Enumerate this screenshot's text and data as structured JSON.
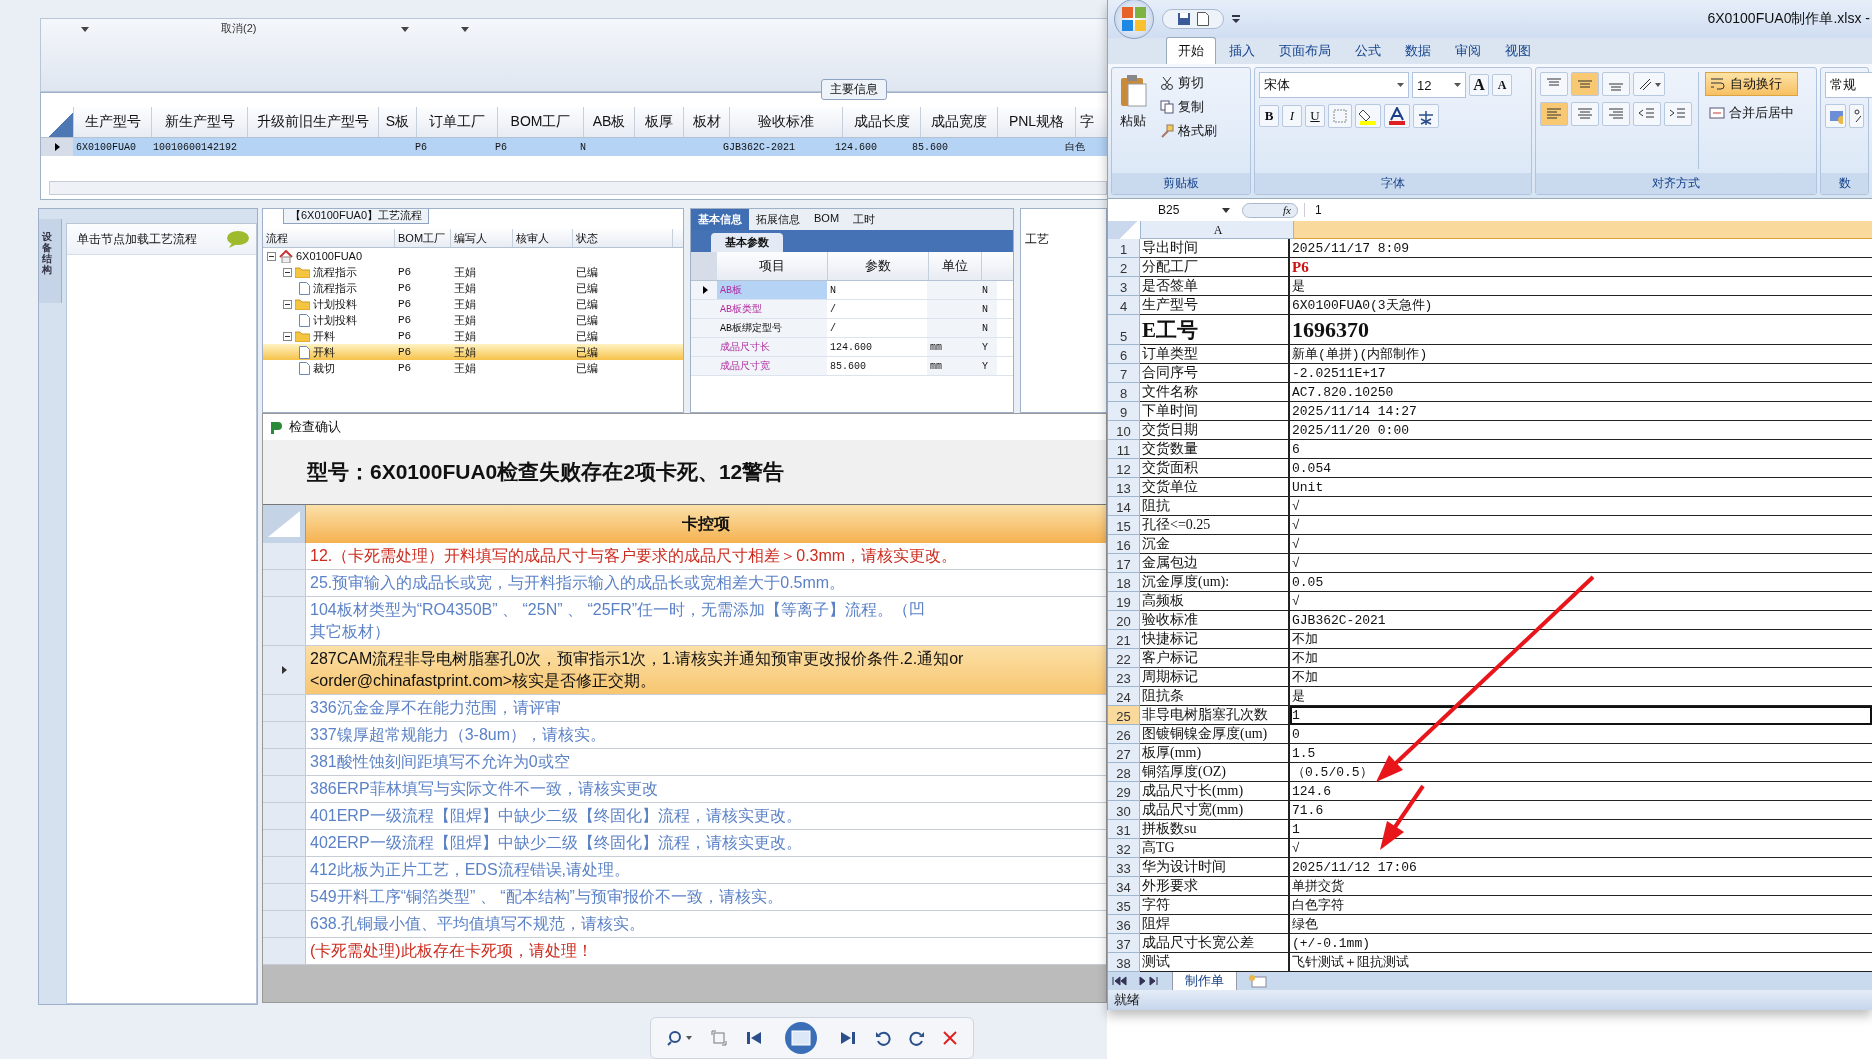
{
  "filter_bar": {
    "label": "取消(2)"
  },
  "main_info": {
    "title": "主要信息",
    "columns": [
      "生产型号",
      "新生产型号",
      "升级前旧生产型号",
      "S板",
      "订单工厂",
      "BOM工厂",
      "AB板",
      "板厚",
      "板材",
      "验收标准",
      "成品长度",
      "成品宽度",
      "PNL规格",
      "字"
    ],
    "rows": [
      {
        "selected": true,
        "cells": [
          "6X0100FUA0",
          "10010600142192",
          null,
          null,
          "P6",
          "P6",
          "N",
          null,
          null,
          "GJB362C-2021",
          "124.600",
          "85.600",
          null,
          "白色"
        ]
      }
    ]
  },
  "side_panel": {
    "tab": "设备结构",
    "hint": "单击节点加载工艺流程"
  },
  "process_panel": {
    "title": "【6X0100FUA0】工艺流程",
    "columns": [
      "流程",
      "BOM工厂",
      "编写人",
      "核审人",
      "状态"
    ],
    "tree": [
      {
        "label": "6X0100FUA0",
        "kind": "root",
        "expanded": true,
        "selected": false,
        "children": [
          {
            "label": "流程指示",
            "kind": "folder",
            "expanded": true,
            "selected": false,
            "factory": "P6",
            "author": "王娟",
            "status": "已编",
            "children": [
              {
                "label": "流程指示",
                "kind": "doc",
                "selected": false,
                "factory": "P6",
                "author": "王娟",
                "status": "已编"
              }
            ]
          },
          {
            "label": "计划投料",
            "kind": "folder",
            "expanded": true,
            "selected": false,
            "factory": "P6",
            "author": "王娟",
            "status": "已编",
            "children": [
              {
                "label": "计划投料",
                "kind": "doc",
                "selected": false,
                "factory": "P6",
                "author": "王娟",
                "status": "已编"
              }
            ]
          },
          {
            "label": "开料",
            "kind": "folder",
            "expanded": true,
            "selected": false,
            "factory": "P6",
            "author": "王娟",
            "status": "已编",
            "children": [
              {
                "label": "开料",
                "kind": "doc",
                "selected": true,
                "factory": "P6",
                "author": "王娟",
                "status": "已编"
              },
              {
                "label": "裁切",
                "kind": "doc",
                "selected": false,
                "factory": "P6",
                "author": "王娟",
                "status": "已编"
              }
            ]
          }
        ]
      }
    ]
  },
  "info_panel": {
    "tabs": [
      {
        "label": "基本信息",
        "selected": true
      },
      {
        "label": "拓展信息",
        "selected": false
      },
      {
        "label": "BOM",
        "selected": false
      },
      {
        "label": "工时",
        "selected": false
      }
    ],
    "subtab": "基本参数",
    "columns": [
      "项目",
      "参数",
      "单位"
    ],
    "rows": [
      {
        "item": "AB板",
        "value": "N",
        "unit": null,
        "column_4": "N",
        "emphasized": true,
        "selected": true
      },
      {
        "item": "AB板类型",
        "value": "/",
        "unit": null,
        "column_4": "N",
        "emphasized": true,
        "selected": false
      },
      {
        "item": "AB板绑定型号",
        "value": "/",
        "unit": null,
        "column_4": "N",
        "emphasized": false,
        "selected": false
      },
      {
        "item": "成品尺寸长",
        "value": "124.600",
        "unit": "mm",
        "column_4": "Y",
        "emphasized": true,
        "selected": false
      },
      {
        "item": "成品尺寸宽",
        "value": "85.600",
        "unit": "mm",
        "column_4": "Y",
        "emphasized": true,
        "selected": false
      }
    ]
  },
  "side_panel_2": {
    "title": "工艺"
  },
  "dialog": {
    "title": "检查确认",
    "heading": "型号：6X0100FUA0检查失败存在2项卡死、12警告",
    "column": "卡控项",
    "items": [
      {
        "kind": "blocker",
        "selected": false,
        "lines": [
          "12.（卡死需处理）开料填写的成品尺寸与客户要求的成品尺寸相差＞0.3mm，请核实更改。"
        ]
      },
      {
        "kind": "warning",
        "selected": false,
        "lines": [
          "25.预审输入的成品长或宽，与开料指示输入的成品长或宽相差大于0.5mm。"
        ]
      },
      {
        "kind": "warning",
        "selected": false,
        "lines": [
          "104板材类型为“RO4350B” 、 “25N” 、 “25FR”任一时，无需添加【等离子】流程。（凹",
          "其它板材）"
        ]
      },
      {
        "kind": "warning",
        "selected": true,
        "lines": [
          "287CAM流程非导电树脂塞孔0次，预审指示1次，1.请核实并通知预审更改报价条件.2.通知or",
          "<order@chinafastprint.com>核实是否修正交期。"
        ]
      },
      {
        "kind": "warning",
        "selected": false,
        "lines": [
          "336沉金金厚不在能力范围，请评审"
        ]
      },
      {
        "kind": "warning",
        "selected": false,
        "lines": [
          "337镍厚超常规能力（3-8um），请核实。"
        ]
      },
      {
        "kind": "warning",
        "selected": false,
        "lines": [
          "381酸性蚀刻间距填写不允许为0或空"
        ]
      },
      {
        "kind": "warning",
        "selected": false,
        "lines": [
          "386ERP菲林填写与实际文件不一致，请核实更改"
        ]
      },
      {
        "kind": "warning",
        "selected": false,
        "lines": [
          "401ERP一级流程【阻焊】中缺少二级【终固化】流程，请核实更改。"
        ]
      },
      {
        "kind": "warning",
        "selected": false,
        "lines": [
          "402ERP一级流程【阻焊】中缺少二级【终固化】流程，请核实更改。"
        ]
      },
      {
        "kind": "warning",
        "selected": false,
        "lines": [
          "412此板为正片工艺，EDS流程错误,请处理。"
        ]
      },
      {
        "kind": "warning",
        "selected": false,
        "lines": [
          "549开料工序“铜箔类型” 、 “配本结构”与预审报价不一致，请核实。"
        ]
      },
      {
        "kind": "warning",
        "selected": false,
        "lines": [
          "638.孔铜最小值、平均值填写不规范，请核实。"
        ]
      },
      {
        "kind": "blocker",
        "selected": false,
        "lines": [
          "(卡死需处理)此板存在卡死项，请处理！"
        ]
      }
    ]
  },
  "excel": {
    "title": "6X0100FUA0制作单.xlsx -",
    "tabs": [
      {
        "label": "开始",
        "selected": true
      },
      {
        "label": "插入",
        "selected": false
      },
      {
        "label": "页面布局",
        "selected": false
      },
      {
        "label": "公式",
        "selected": false
      },
      {
        "label": "数据",
        "selected": false
      },
      {
        "label": "审阅",
        "selected": false
      },
      {
        "label": "视图",
        "selected": false
      }
    ],
    "clipboard": {
      "label": "剪贴板",
      "paste": "粘贴",
      "cut": "剪切",
      "copy": "复制",
      "format_painter": "格式刷"
    },
    "font": {
      "label": "字体",
      "family": "宋体",
      "size": "12",
      "grow": "A",
      "shrink": "A",
      "bold": "B",
      "italic": "I",
      "underline": "U"
    },
    "alignment": {
      "label": "对齐方式",
      "wrap_text": {
        "label": "自动换行",
        "on": true
      },
      "merge": "合并后居中"
    },
    "number": {
      "label": "数",
      "format": "常规"
    },
    "name_box": "B25",
    "function_label": "fx",
    "formula": "1",
    "column": "A",
    "rows": [
      {
        "num": "1",
        "label": "导出时间",
        "value": "2025/11/17 8:09",
        "kind": "normal",
        "selected": false
      },
      {
        "num": "2",
        "label": "分配工厂",
        "value": "P6",
        "kind": "red",
        "selected": false
      },
      {
        "num": "3",
        "label": "是否签单",
        "value": "是",
        "kind": "normal",
        "selected": false
      },
      {
        "num": "4",
        "label": "生产型号",
        "value": "6X0100FUA0(3天急件)",
        "kind": "normal",
        "selected": false
      },
      {
        "num": "5",
        "label": "E工号",
        "value": "1696370",
        "kind": "large",
        "selected": false
      },
      {
        "num": "6",
        "label": "订单类型",
        "value": "新单(单拼)(内部制作)",
        "kind": "normal",
        "selected": false
      },
      {
        "num": "7",
        "label": "合同序号",
        "value": "-2.02511E+17",
        "kind": "normal",
        "selected": false
      },
      {
        "num": "8",
        "label": "文件名称",
        "value": "AC7.820.10250",
        "kind": "normal",
        "selected": false
      },
      {
        "num": "9",
        "label": "下单时间",
        "value": "2025/11/14 14:27",
        "kind": "normal",
        "selected": false
      },
      {
        "num": "10",
        "label": "交货日期",
        "value": "2025/11/20 0:00",
        "kind": "normal",
        "selected": false
      },
      {
        "num": "11",
        "label": "交货数量",
        "value": "6",
        "kind": "normal",
        "selected": false
      },
      {
        "num": "12",
        "label": "交货面积",
        "value": "0.054",
        "kind": "normal",
        "selected": false
      },
      {
        "num": "13",
        "label": "交货单位",
        "value": "Unit",
        "kind": "normal",
        "selected": false
      },
      {
        "num": "14",
        "label": "阻抗",
        "value": "√",
        "kind": "normal",
        "selected": false
      },
      {
        "num": "15",
        "label": "孔径<=0.25",
        "value": "√",
        "kind": "normal",
        "selected": false
      },
      {
        "num": "16",
        "label": "沉金",
        "value": "√",
        "kind": "normal",
        "selected": false
      },
      {
        "num": "17",
        "label": "金属包边",
        "value": "√",
        "kind": "normal",
        "selected": false
      },
      {
        "num": "18",
        "label": "沉金厚度(um):",
        "value": "0.05",
        "kind": "normal",
        "selected": false
      },
      {
        "num": "19",
        "label": "高频板",
        "value": "√",
        "kind": "normal",
        "selected": false
      },
      {
        "num": "20",
        "label": "验收标准",
        "value": "GJB362C-2021",
        "kind": "normal",
        "selected": false
      },
      {
        "num": "21",
        "label": "快捷标记",
        "value": "不加",
        "kind": "normal",
        "selected": false
      },
      {
        "num": "22",
        "label": "客户标记",
        "value": "不加",
        "kind": "normal",
        "selected": false
      },
      {
        "num": "23",
        "label": "周期标记",
        "value": "不加",
        "kind": "normal",
        "selected": false
      },
      {
        "num": "24",
        "label": "阻抗条",
        "value": "是",
        "kind": "normal",
        "selected": false
      },
      {
        "num": "25",
        "label": "非导电树脂塞孔次数",
        "value": "1",
        "kind": "normal",
        "selected": true
      },
      {
        "num": "26",
        "label": "图镀铜镍金厚度(um)",
        "value": "0",
        "kind": "normal",
        "selected": false
      },
      {
        "num": "27",
        "label": "板厚(mm)",
        "value": "1.5",
        "kind": "normal",
        "selected": false
      },
      {
        "num": "28",
        "label": "铜箔厚度(OZ)",
        "value": "（0.5/0.5）",
        "kind": "normal",
        "selected": false
      },
      {
        "num": "29",
        "label": "成品尺寸长(mm)",
        "value": "124.6",
        "kind": "normal",
        "selected": false
      },
      {
        "num": "30",
        "label": "成品尺寸宽(mm)",
        "value": "71.6",
        "kind": "normal",
        "selected": false
      },
      {
        "num": "31",
        "label": "拼板数su",
        "value": "1",
        "kind": "normal",
        "selected": false
      },
      {
        "num": "32",
        "label": "高TG",
        "value": "√",
        "kind": "normal",
        "selected": false
      },
      {
        "num": "33",
        "label": "华为设计时间",
        "value": "2025/11/12 17:06",
        "kind": "normal",
        "selected": false
      },
      {
        "num": "34",
        "label": "外形要求",
        "value": "单拼交货",
        "kind": "normal",
        "selected": false
      },
      {
        "num": "35",
        "label": "字符",
        "value": "白色字符",
        "kind": "normal",
        "selected": false
      },
      {
        "num": "36",
        "label": "阻焊",
        "value": "绿色",
        "kind": "normal",
        "selected": false
      },
      {
        "num": "37",
        "label": "成品尺寸长宽公差",
        "value": "(+/-0.1mm)",
        "kind": "normal",
        "selected": false
      },
      {
        "num": "38",
        "label": "测试",
        "value": "飞针测试＋阻抗测试",
        "kind": "normal",
        "selected": false
      }
    ],
    "sheet_tab": "制作单",
    "status": "就绪"
  }
}
